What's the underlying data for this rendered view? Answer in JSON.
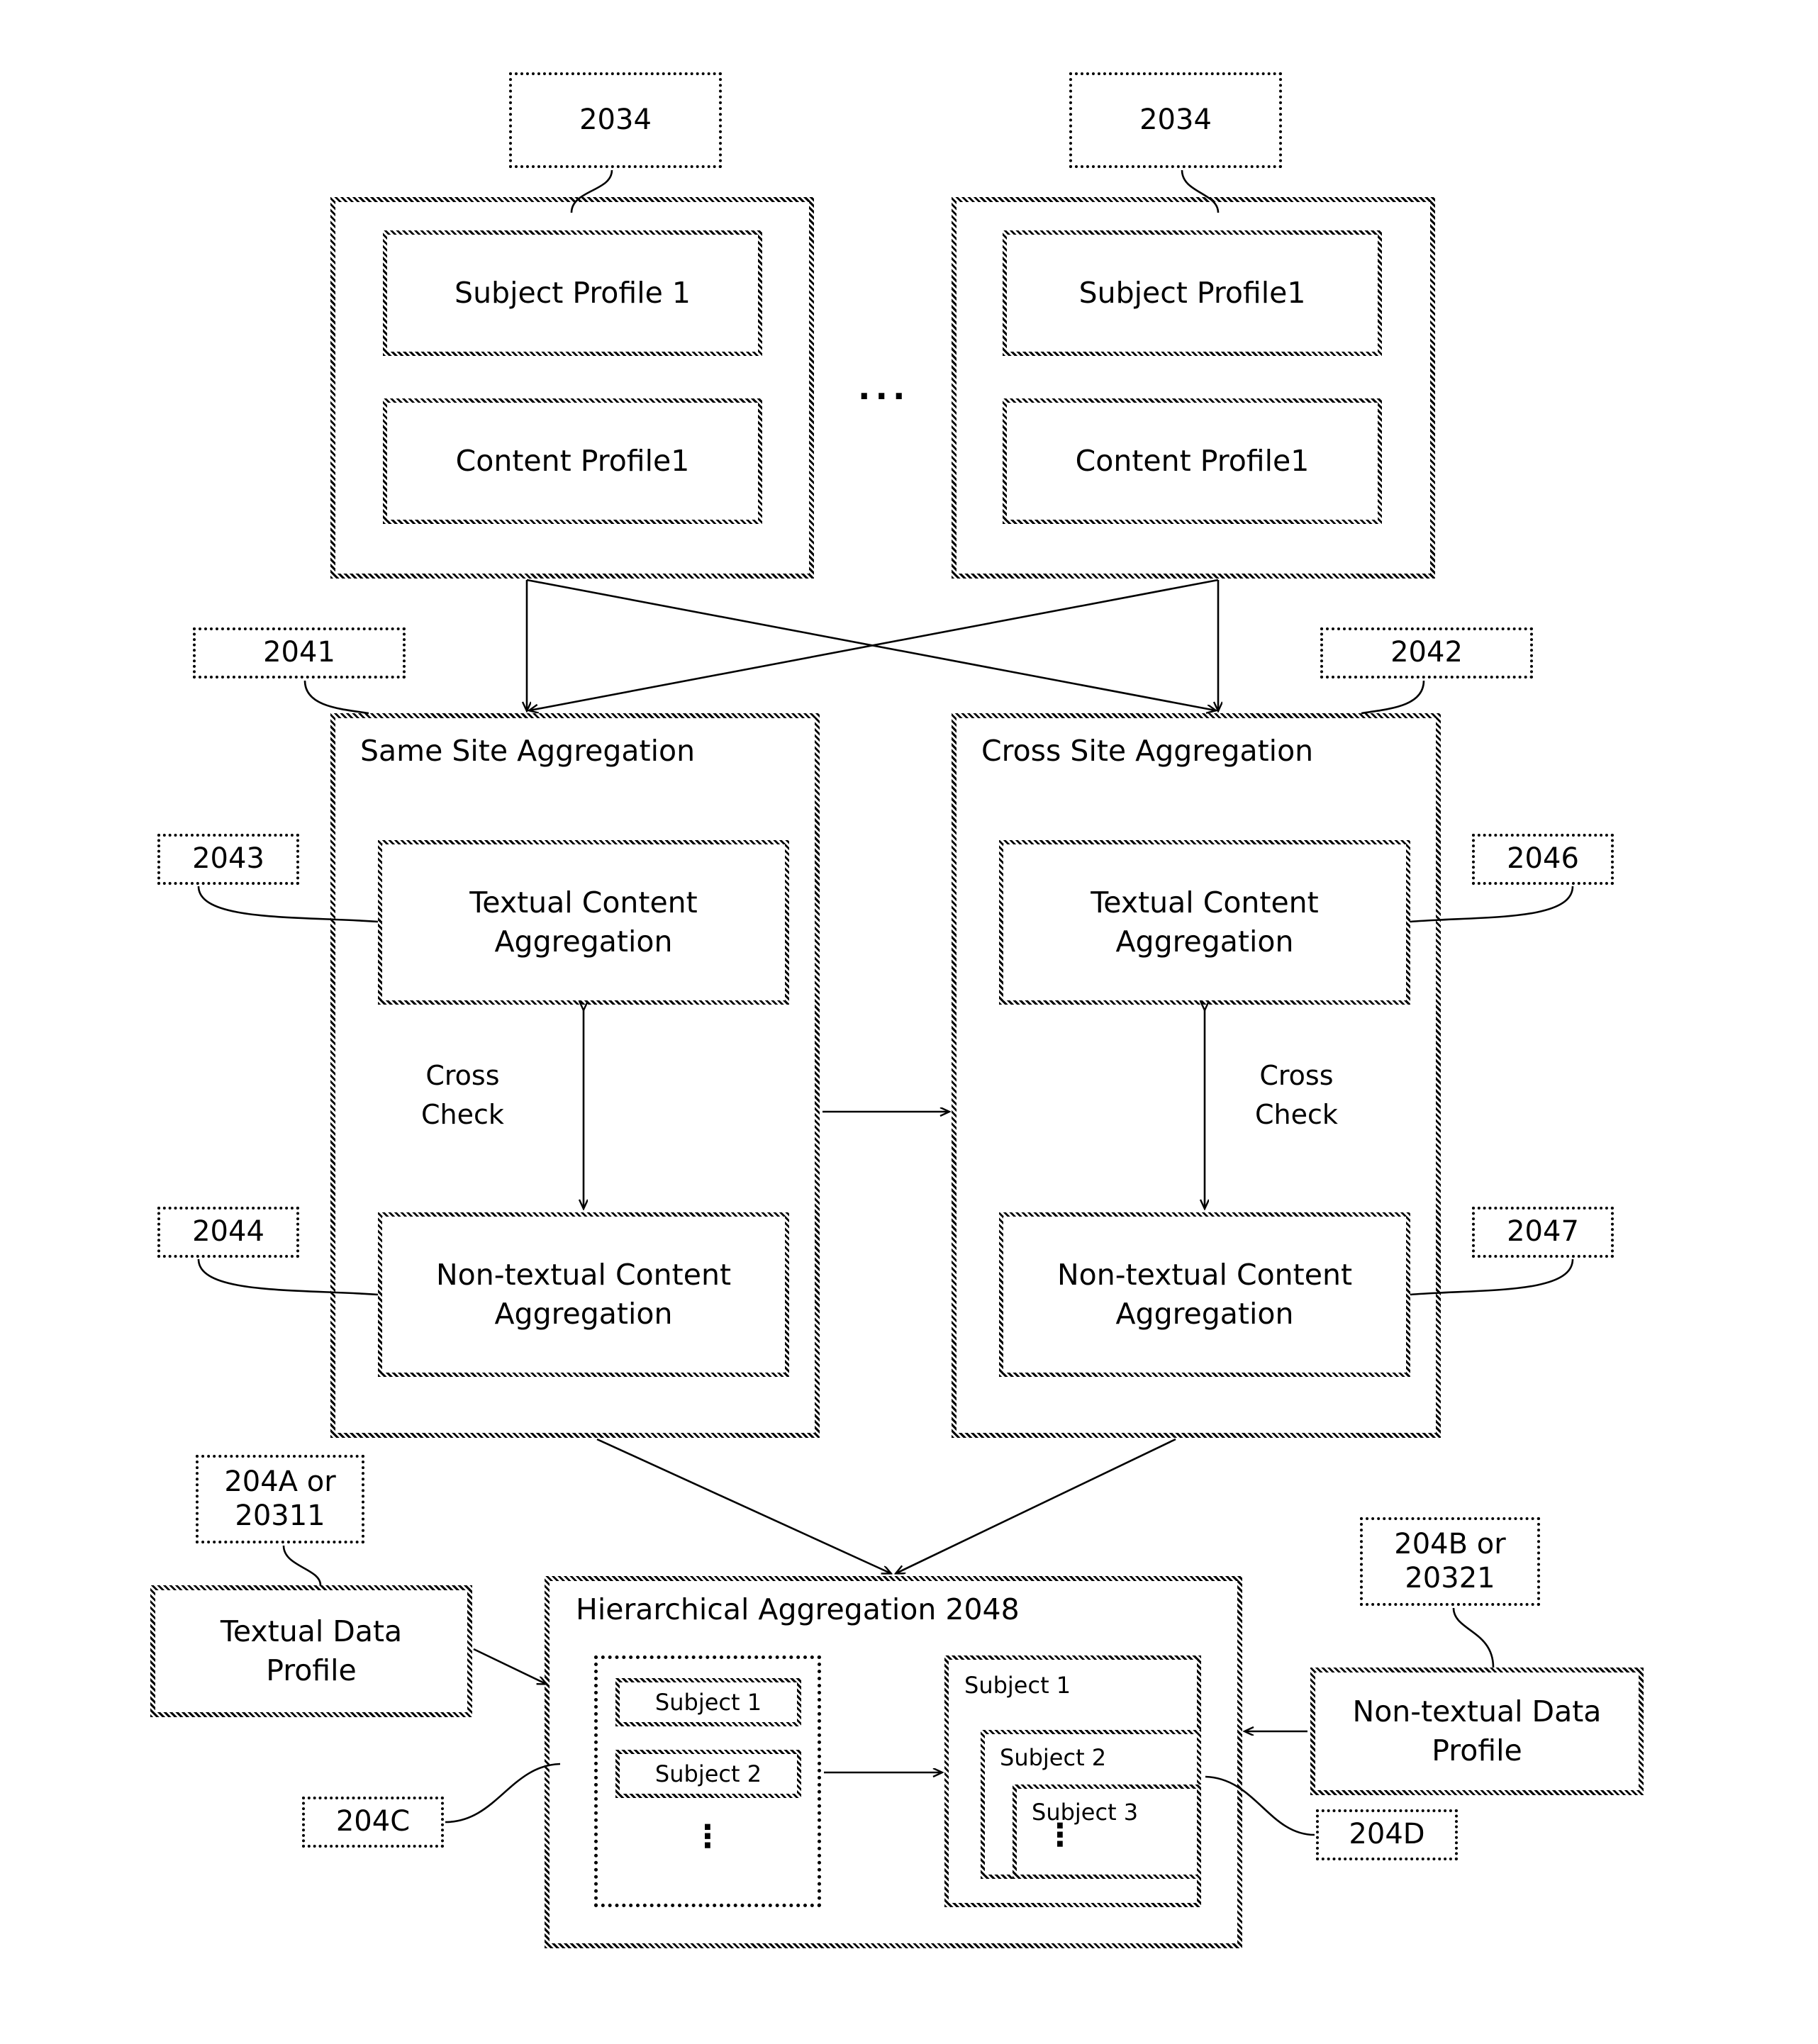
{
  "figure": {
    "title": "Hierarchical content aggregation diagram",
    "refs": {
      "r2034_left": "2034",
      "r2034_right": "2034",
      "r2041": "2041",
      "r2042": "2042",
      "r2043": "2043",
      "r2044": "2044",
      "r2046": "2046",
      "r2047": "2047",
      "r204A": "204A or\n20311",
      "r204B": "204B or\n20321",
      "r204C": "204C",
      "r204D": "204D"
    },
    "ellipsis_between_sources": "...",
    "sources": [
      {
        "name": "source-group-left",
        "subject_profile": "Subject Profile 1",
        "content_profile": "Content Profile1"
      },
      {
        "name": "source-group-right",
        "subject_profile": "Subject Profile1",
        "content_profile": "Content Profile1"
      }
    ],
    "aggregations": [
      {
        "name": "same-site-aggregation",
        "title": "Same Site Aggregation",
        "textual": "Textual Content\nAggregation",
        "non_textual": "Non-textual Content\nAggregation",
        "cross_check": "Cross\nCheck"
      },
      {
        "name": "cross-site-aggregation",
        "title": "Cross Site Aggregation",
        "textual": "Textual Content\nAggregation",
        "non_textual": "Non-textual Content\nAggregation",
        "cross_check": "Cross\nCheck"
      }
    ],
    "profiles": {
      "textual_data_profile": "Textual  Data\nProfile",
      "non_textual_data_profile": "Non-textual Data\nProfile"
    },
    "hierarchical": {
      "title": "Hierarchical Aggregation 2048",
      "flat_list": [
        "Subject 1",
        "Subject 2"
      ],
      "flat_ellipsis": "⋮",
      "nested_list": [
        "Subject 1",
        "Subject 2",
        "Subject 3"
      ],
      "nested_ellipsis": "⋮"
    }
  }
}
